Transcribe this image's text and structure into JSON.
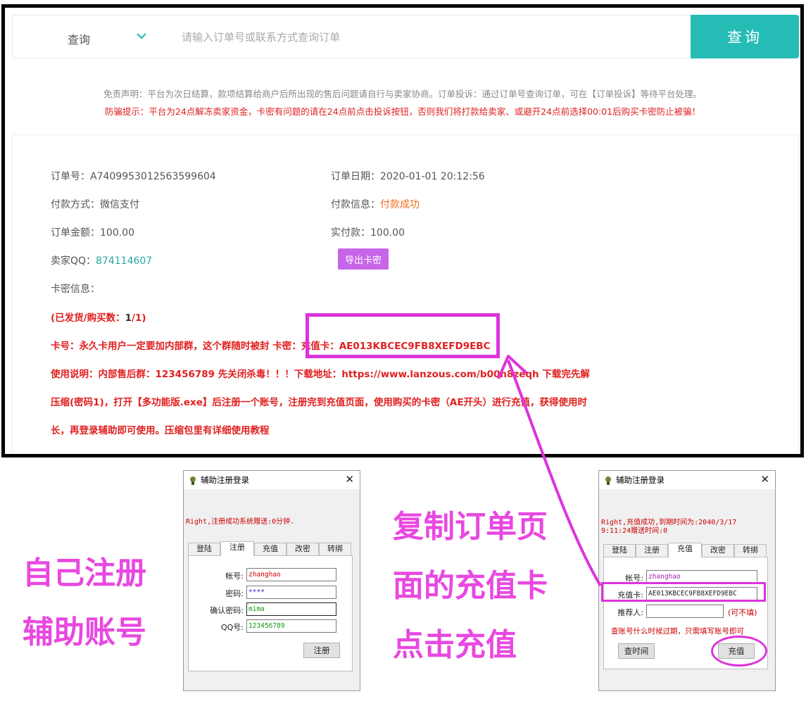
{
  "search": {
    "query_label": "查询",
    "placeholder": "请输入订单号或联系方式查询订单",
    "button_label": "查询"
  },
  "notices": {
    "disclaimer": "免责声明：平台为次日结算，款项结算给商户后所出现的售后问题请自行与卖家协商。订单投诉：通过订单号查询订单，可在【订单投诉】等待平台处理。",
    "fraud_tip": "防骗提示：平台为24点解冻卖家资金，卡密有问题的请在24点前点击投诉按钮，否则我们将打款给卖家、或避开24点前选择00:01后购买卡密防止被骗！"
  },
  "order": {
    "order_no_label": "订单号：",
    "order_no": "A7409953012563599604",
    "order_date_label": "订单日期：",
    "order_date": "2020-01-01 20:12:56",
    "pay_method_label": "付款方式：",
    "pay_method": "微信支付",
    "pay_info_label": "付款信息：",
    "pay_info": "付款成功",
    "amount_label": "订单金额：",
    "amount": "100.00",
    "paid_label": "实付款：",
    "paid": "100.00",
    "seller_qq_label": "卖家QQ：",
    "seller_qq": "874114607",
    "export_button": "导出卡密",
    "card_info_label": "卡密信息：",
    "shipped_prefix": "(已发货/购买数：",
    "shipped_count": "1",
    "shipped_total": "/1)",
    "card_line": "卡号：永久卡用户一定要加内部群，这个群随时被封  卡密：充值卡：AE013KBCEC9FB8XEFD9EBC",
    "usage_line1": "使用说明：内部售后群：123456789   先关闭杀毒！！！下载地址：https://www.lanzous.com/b00n8zeqh     下载完先解",
    "usage_line2": "压缩(密码1)，打开【多功能版.exe】后注册一个账号，注册完到充值页面，使用购买的卡密（AE开头）进行充值，获得使用时",
    "usage_line3": "长，再登录辅助即可使用。压缩包里有详细使用教程"
  },
  "captions": {
    "left_line1": "自己注册",
    "left_line2": "辅助账号",
    "mid_line1": "复制订单页",
    "mid_line2": "面的充值卡",
    "mid_line3": "点击充值"
  },
  "dialog_register": {
    "title": "辅助注册登录",
    "status": "Right,注册成功系统赠送:0分钟.",
    "tabs": [
      "登陆",
      "注册",
      "充值",
      "改密",
      "转绑"
    ],
    "active_tab": "注册",
    "fields": [
      {
        "label": "帐号:",
        "value": "zhanghao"
      },
      {
        "label": "密码:",
        "value": "****"
      },
      {
        "label": "确认密码:",
        "value": "mima"
      },
      {
        "label": "QQ号:",
        "value": "123456789"
      }
    ],
    "submit_button": "注册"
  },
  "dialog_recharge": {
    "title": "辅助注册登录",
    "status_line1": "Right,充值成功,到期时间为:2040/3/17",
    "status_line2": "9:11:24赠送时间:0",
    "tabs": [
      "登陆",
      "注册",
      "充值",
      "改密",
      "转绑"
    ],
    "active_tab": "充值",
    "account_label": "帐号:",
    "account_value": "zhanghao",
    "card_label": "充值卡:",
    "card_value": "AE013KBCEC9FB8XEFD9EBC",
    "referrer_label": "推荐人:",
    "referrer_hint": "(可不填)",
    "expiry_hint": "查账号什么时候过期，只需填写账号即可",
    "check_button": "查时间",
    "recharge_button": "充值"
  },
  "colors": {
    "accent_teal": "#25bcb6",
    "highlight_pink": "#dd33dd",
    "caption_pink": "#e848e0",
    "warning_red": "#e02020",
    "export_purple": "#c765e8"
  }
}
